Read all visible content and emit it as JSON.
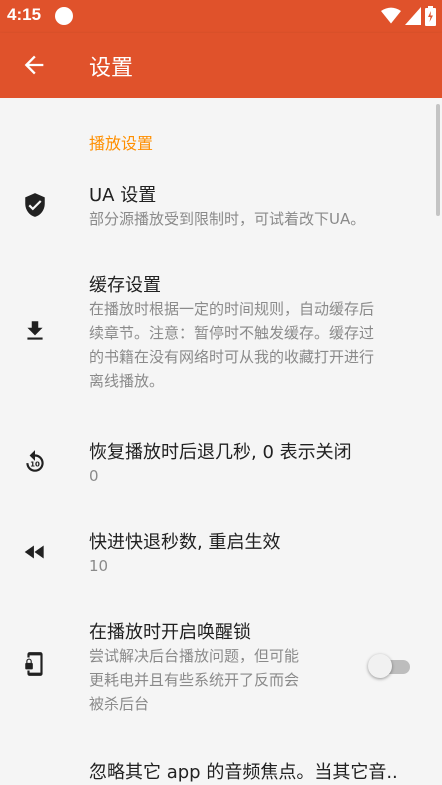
{
  "status_bar": {
    "time": "4:15"
  },
  "app_bar": {
    "title": "设置"
  },
  "category": {
    "label": "播放设置"
  },
  "prefs": [
    {
      "title": "UA 设置",
      "summary": "部分源播放受到限制时，可试着改下UA。",
      "icon": "shield-check-icon"
    },
    {
      "title": "缓存设置",
      "summary_lines": [
        "在播放时根据一定的时间规则，自动缓存后",
        "续章节。注意：暂停时不触发缓存。缓存过",
        "的书籍在没有网络时可从我的收藏打开进行",
        "离线播放。"
      ],
      "icon": "download-icon"
    },
    {
      "title": "恢复播放时后退几秒, 0 表示关闭",
      "summary": "0",
      "icon": "replay-10-icon"
    },
    {
      "title": "快进快退秒数, 重启生效",
      "summary": "10",
      "icon": "rewind-icon"
    },
    {
      "title": "在播放时开启唤醒锁",
      "summary_lines": [
        "尝试解决后台播放问题，但可能",
        "更耗电并且有些系统开了反而会",
        "被杀后台"
      ],
      "icon": "phone-lock-icon",
      "switch_on": false
    },
    {
      "title": "忽略其它 app 的音频焦点。当其它音.."
    }
  ],
  "colors": {
    "primary": "#e0522b",
    "accent": "#ff8f00"
  }
}
